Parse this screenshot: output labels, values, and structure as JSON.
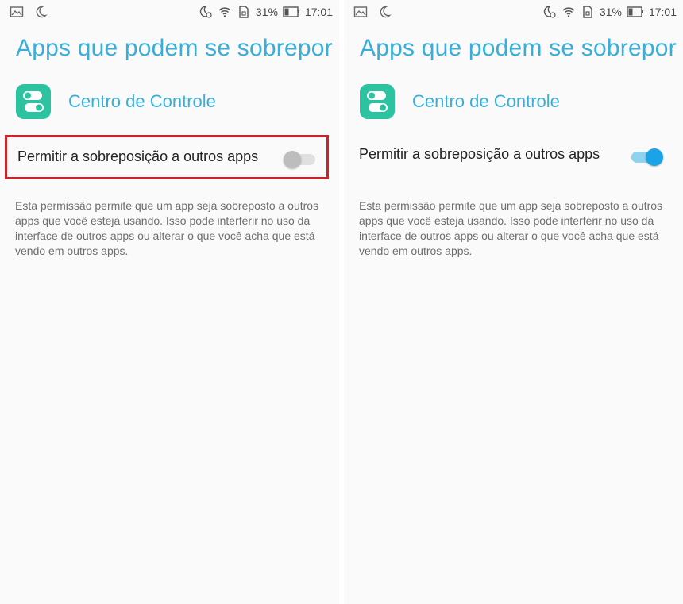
{
  "status_bar": {
    "battery_percent": "31%",
    "time": "17:01",
    "icons": [
      "image-icon",
      "moon-icon",
      "alarm-moon-icon",
      "wifi-icon",
      "sim-icon",
      "battery-icon"
    ]
  },
  "screens": [
    {
      "title": "Apps que podem se sobrepor…",
      "app_name": "Centro de Controle",
      "setting_label": "Permitir a sobreposição a outros apps",
      "toggle_state": "off",
      "description": "Esta permissão permite que um app seja sobreposto a outros apps que você esteja usando. Isso pode interferir no uso da interface de outros apps ou alterar o que você acha que está vendo em outros apps."
    },
    {
      "title": "Apps que podem se sobrepor…",
      "app_name": "Centro de Controle",
      "setting_label": "Permitir a sobreposição a outros apps",
      "toggle_state": "on",
      "description": "Esta permissão permite que um app seja sobreposto a outros apps que você esteja usando. Isso pode interferir no uso da interface de outros apps ou alterar o que você acha que está vendo em outros apps."
    }
  ],
  "colors": {
    "accent": "#3aaed8",
    "app_icon": "#2ec3a0",
    "toggle_on": "#1aa3e6",
    "highlight": "#c8252a"
  }
}
